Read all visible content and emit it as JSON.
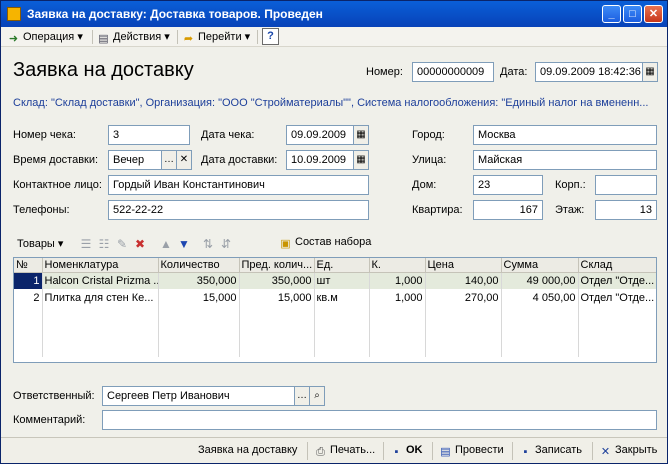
{
  "window": {
    "title": "Заявка на доставку: Доставка товаров. Проведен"
  },
  "titlebar_buttons": {
    "minimize": "_",
    "maximize": "□",
    "close": "✕"
  },
  "menu": {
    "operation": "Операция",
    "actions": "Действия",
    "goto": "Перейти",
    "help": "?"
  },
  "form": {
    "title": "Заявка на доставку",
    "number_label": "Номер:",
    "number_value": "00000000009",
    "date_label": "Дата:",
    "date_value": "09.09.2009 18:42:36",
    "info": "Склад: \"Склад доставки\", Организация: \"ООО \"Стройматериалы\"\", Система налогообложения: \"Единый налог на вмененн..."
  },
  "fields": {
    "check_number_label": "Номер чека:",
    "check_number_value": "3",
    "check_date_label": "Дата чека:",
    "check_date_value": "09.09.2009",
    "city_label": "Город:",
    "city_value": "Москва",
    "delivery_time_label": "Время доставки:",
    "delivery_time_value": "Вечер",
    "delivery_date_label": "Дата доставки:",
    "delivery_date_value": "10.09.2009",
    "street_label": "Улица:",
    "street_value": "Майская",
    "contact_label": "Контактное лицо:",
    "contact_value": "Гордый Иван Константинович",
    "house_label": "Дом:",
    "house_value": "23",
    "building_label": "Корп.:",
    "building_value": "",
    "phones_label": "Телефоны:",
    "phones_value": "522-22-22",
    "apartment_label": "Квартира:",
    "apartment_value": "167",
    "floor_label": "Этаж:",
    "floor_value": "13"
  },
  "goods": {
    "menu_label": "Товары",
    "kit_button": "Состав набора",
    "columns": [
      "№",
      "Номенклатура",
      "Количество",
      "Пред. колич...",
      "Ед.",
      "К.",
      "Цена",
      "Сумма",
      "Склад"
    ],
    "rows": [
      [
        "1",
        "Halcon Cristal Prizma ...",
        "350,000",
        "350,000",
        "шт",
        "1,000",
        "140,00",
        "49 000,00",
        "Отдел \"Отде..."
      ],
      [
        "2",
        "Плитка для стен Ке...",
        "15,000",
        "15,000",
        "кв.м",
        "1,000",
        "270,00",
        "4 050,00",
        "Отдел \"Отде..."
      ]
    ]
  },
  "footer_fields": {
    "responsible_label": "Ответственный:",
    "responsible_value": "Сергеев Петр Иванович",
    "comment_label": "Комментарий:",
    "comment_value": ""
  },
  "bottom": {
    "delivery_request": "Заявка на доставку",
    "print": "Печать...",
    "ok": "OK",
    "post": "Провести",
    "save": "Записать",
    "close": "Закрыть"
  }
}
